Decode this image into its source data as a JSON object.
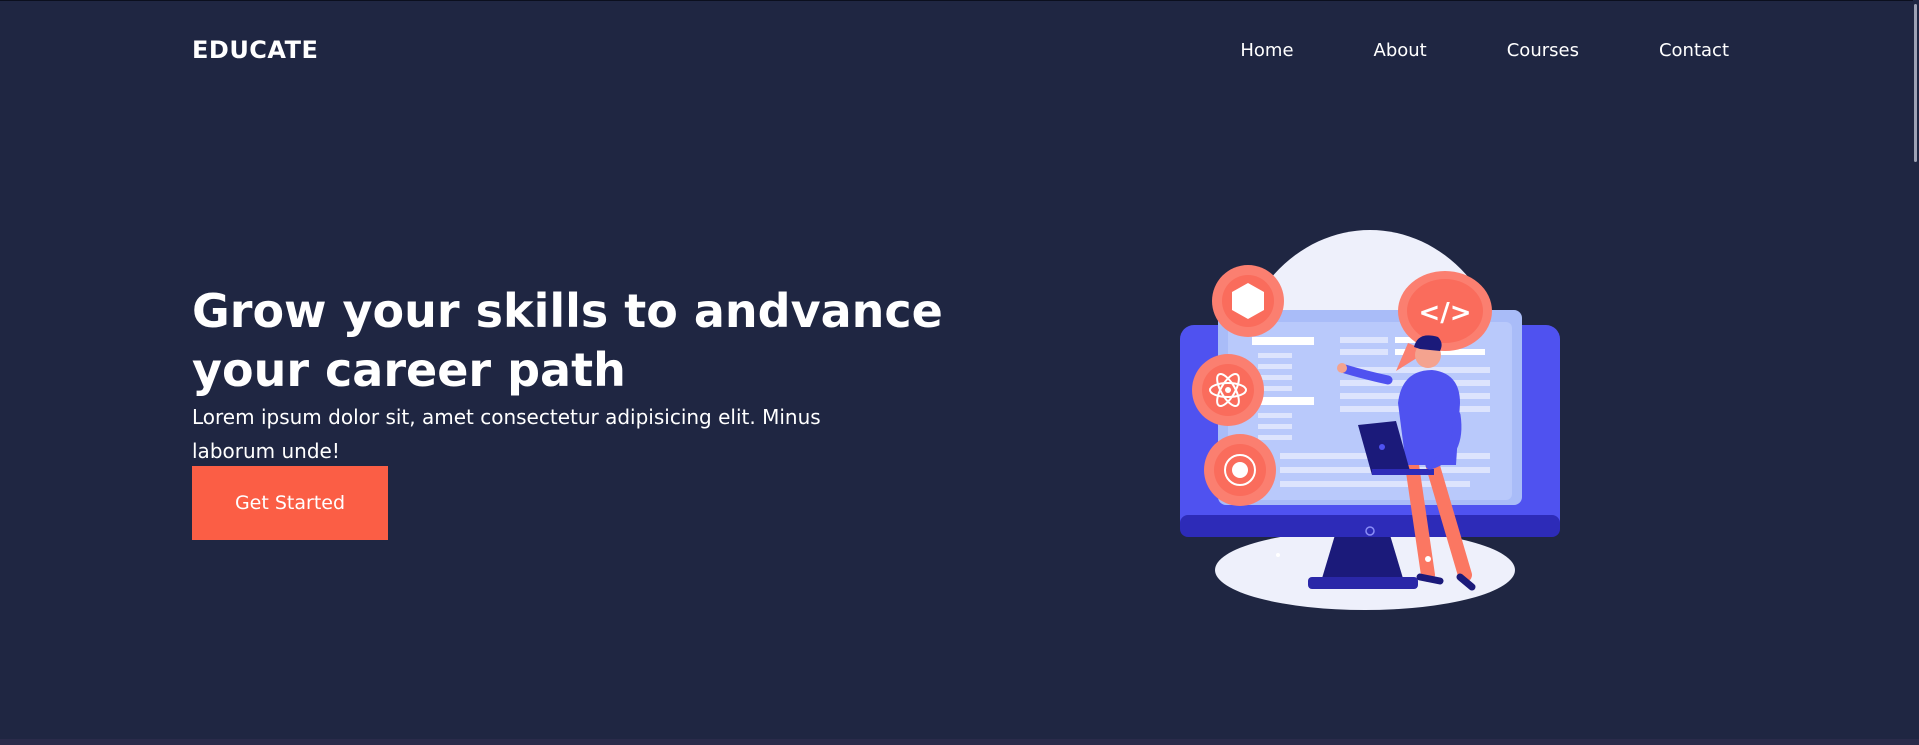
{
  "brand": {
    "name": "EDUCATE"
  },
  "nav": {
    "items": [
      {
        "label": "Home"
      },
      {
        "label": "About"
      },
      {
        "label": "Courses"
      },
      {
        "label": "Contact"
      }
    ]
  },
  "hero": {
    "headline": "Grow your skills to andvance your career path",
    "subtext": "Lorem ipsum dolor sit, amet consectetur adipisicing elit. Minus laborum unde!",
    "cta_label": "Get Started",
    "code_badge": "</>"
  },
  "colors": {
    "background": "#1f2642",
    "accent": "#fb5e45",
    "illustration_blue": "#4f52f0",
    "illustration_light": "#a9bcf8"
  }
}
